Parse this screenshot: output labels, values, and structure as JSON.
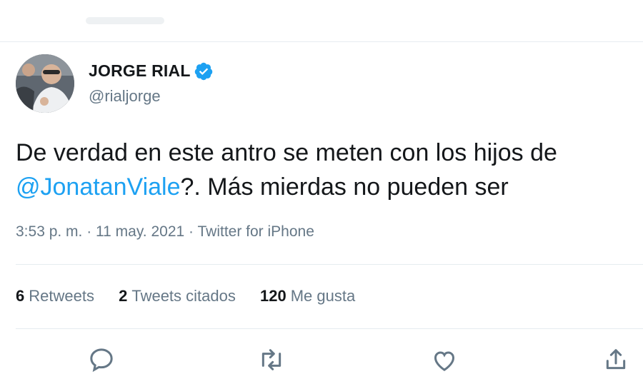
{
  "tweet": {
    "author": {
      "display_name": "JORGE RIAL",
      "handle": "@rialjorge",
      "verified": true
    },
    "text_line1": "De verdad en este antro se meten con los hijos de",
    "mention": "@JonatanViale",
    "text_line2_rest": "?. Más mierdas no pueden ser",
    "timestamp": "3:53 p. m. · 11 may. 2021",
    "meta_separator": " · ",
    "source": "Twitter for iPhone",
    "stats": {
      "retweets_count": "6",
      "retweets_label": "Retweets",
      "quotes_count": "2",
      "quotes_label": "Tweets citados",
      "likes_count": "120",
      "likes_label": "Me gusta"
    }
  },
  "actions": {
    "icons": [
      "reply-icon",
      "retweet-icon",
      "like-icon",
      "share-icon"
    ]
  },
  "colors": {
    "text": "#14171a",
    "secondary": "#657786",
    "accent": "#1da1f2",
    "divider": "#e6ecf0"
  }
}
